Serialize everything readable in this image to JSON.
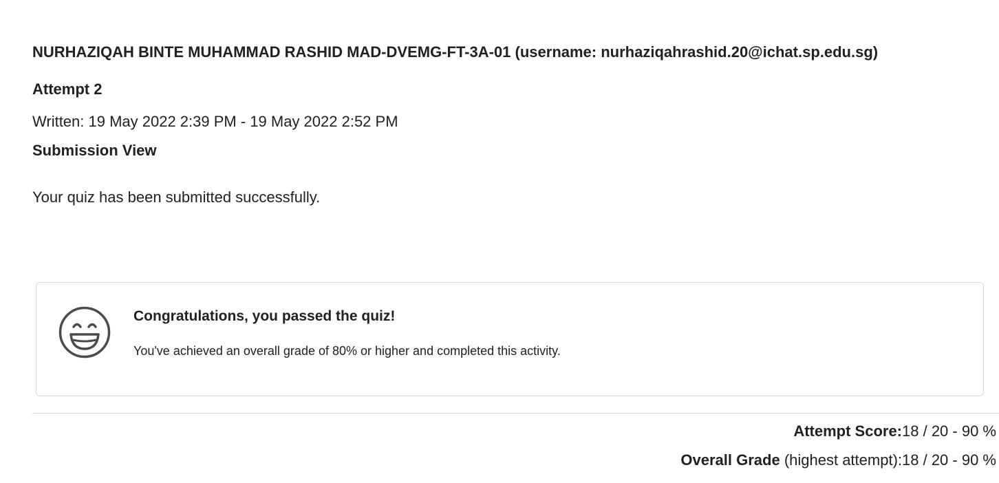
{
  "header": {
    "student_line": "NURHAZIQAH BINTE MUHAMMAD RASHID MAD-DVEMG-FT-3A-01 (username: nurhaziqahrashid.20@ichat.sp.edu.sg)"
  },
  "attempt": {
    "title": "Attempt 2",
    "written": "Written: 19 May 2022 2:39 PM - 19 May 2022 2:52 PM",
    "submission_view": "Submission View",
    "submitted_message": "Your quiz has been submitted successfully."
  },
  "result_card": {
    "icon": "smiley-face-icon",
    "heading": "Congratulations, you passed the quiz!",
    "text": "You've achieved an overall grade of 80% or higher and completed this activity."
  },
  "scores": {
    "attempt_label": "Attempt Score:",
    "attempt_value": "18 / 20 - 90 %",
    "overall_label": "Overall Grade",
    "overall_sublabel": " (highest attempt):",
    "overall_value": "18 / 20 - 90 %"
  },
  "colors": {
    "text": "#202122",
    "border": "#d3d9e3",
    "icon": "#494c4e"
  }
}
